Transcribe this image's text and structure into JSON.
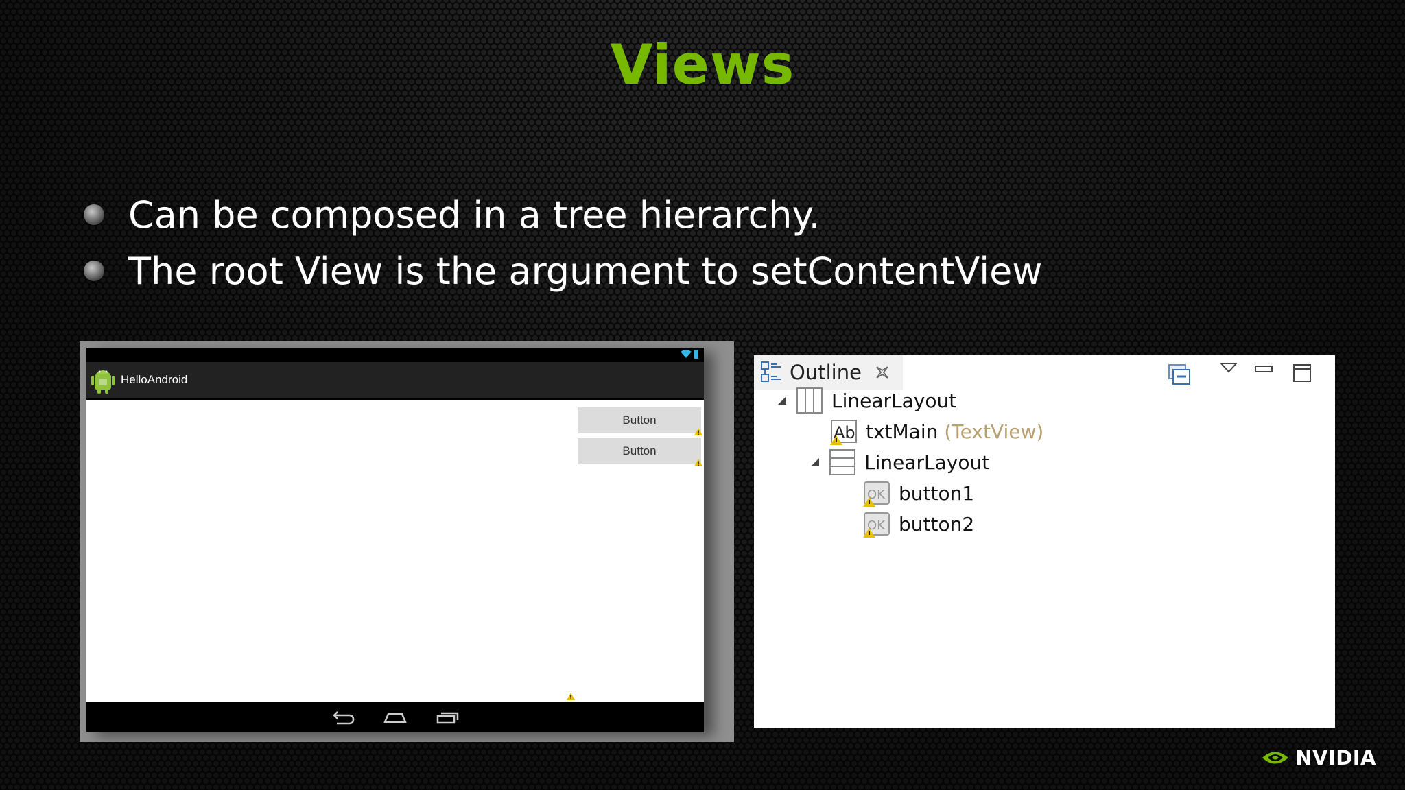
{
  "slide": {
    "title": "Views",
    "bullets": [
      "Can be composed in a tree hierarchy.",
      "The root View is the argument to setContentView"
    ],
    "logo_text": "NVIDIA",
    "accent_color": "#76b900"
  },
  "emulator": {
    "app_name": "HelloAndroid",
    "buttons": [
      "Button",
      "Button"
    ],
    "status_icons": [
      "wifi-icon",
      "battery-icon"
    ],
    "nav_icons": [
      "back-icon",
      "home-icon",
      "recents-icon"
    ]
  },
  "outline": {
    "tab_label": "Outline",
    "controls": [
      "collapse-all-icon",
      "view-menu-icon",
      "minimize-icon",
      "maximize-icon"
    ],
    "tree": [
      {
        "label": "LinearLayout",
        "type": "",
        "icon": "linear-layout-horizontal-icon",
        "depth": 0,
        "expanded": true
      },
      {
        "label": "txtMain",
        "type": "(TextView)",
        "icon": "textview-icon",
        "depth": 1,
        "expanded": null
      },
      {
        "label": "LinearLayout",
        "type": "",
        "icon": "linear-layout-vertical-icon",
        "depth": 1,
        "expanded": true
      },
      {
        "label": "button1",
        "type": "",
        "icon": "button-icon",
        "depth": 2,
        "expanded": null
      },
      {
        "label": "button2",
        "type": "",
        "icon": "button-icon",
        "depth": 2,
        "expanded": null
      }
    ]
  }
}
